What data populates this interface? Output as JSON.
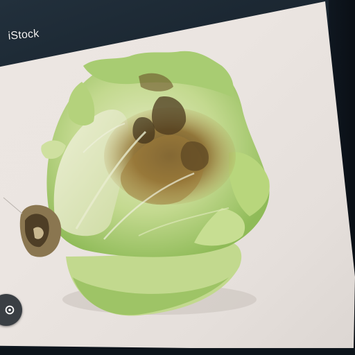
{
  "watermark": {
    "text": "iStock"
  },
  "scene": {
    "subject_icon": "lettuce-head-icon",
    "lens_button_icon": "visual-search-icon"
  },
  "colors": {
    "background": "#ece6e2",
    "bezel": "#121b24",
    "leaf_green": "#9cc46a",
    "leaf_pale": "#dfe8b8",
    "rot_brown": "#7a5a2a"
  }
}
